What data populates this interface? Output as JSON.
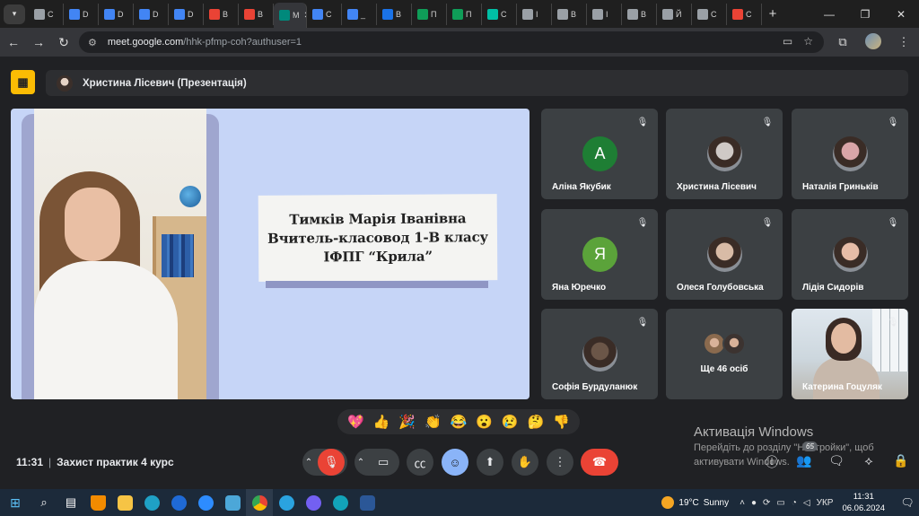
{
  "browser": {
    "tabs": [
      {
        "label": "C",
        "color": "#9aa0a6"
      },
      {
        "label": "D",
        "color": "#4285f4"
      },
      {
        "label": "D",
        "color": "#4285f4"
      },
      {
        "label": "D",
        "color": "#4285f4"
      },
      {
        "label": "D",
        "color": "#4285f4"
      },
      {
        "label": "B",
        "color": "#ea4335"
      },
      {
        "label": "B",
        "color": "#ea4335"
      },
      {
        "label": "M",
        "color": "#00897b",
        "active": true
      },
      {
        "label": "C",
        "color": "#4285f4"
      },
      {
        "label": "_",
        "color": "#4285f4"
      },
      {
        "label": "B",
        "color": "#1a73e8"
      },
      {
        "label": "П",
        "color": "#0f9d58"
      },
      {
        "label": "П",
        "color": "#0f9d58"
      },
      {
        "label": "C",
        "color": "#00bfa5"
      },
      {
        "label": "I",
        "color": "#9aa0a6"
      },
      {
        "label": "B",
        "color": "#9aa0a6"
      },
      {
        "label": "I",
        "color": "#9aa0a6"
      },
      {
        "label": "B",
        "color": "#9aa0a6"
      },
      {
        "label": "Й",
        "color": "#9aa0a6"
      },
      {
        "label": "C",
        "color": "#9aa0a6"
      },
      {
        "label": "C",
        "color": "#ea4335"
      }
    ],
    "url_host": "meet.google.com",
    "url_path": "/hhk-pfmp-coh?authuser=1"
  },
  "meet": {
    "presenter_label": "Христина Лісевич (Презентація)",
    "slide": {
      "line1": "Тимків Марія Іванівна",
      "line2": "Вчитель-класовод 1-В класу",
      "line3": "ІФПГ “Крила”"
    },
    "participants": [
      {
        "name": "Аліна Якубик",
        "initial": "А",
        "color": "#1e7e34",
        "type": "letter"
      },
      {
        "name": "Христина Лісевич",
        "type": "photo",
        "color": "#cfc9c6"
      },
      {
        "name": "Наталія Гриньків",
        "type": "photo",
        "color": "#d9a5a8"
      },
      {
        "name": "Яна Юречко",
        "initial": "Я",
        "color": "#5ba33a",
        "type": "letter"
      },
      {
        "name": "Олеся Голубовська",
        "type": "photo",
        "color": "#d8bba6"
      },
      {
        "name": "Лідія Сидорів",
        "type": "photo",
        "color": "#e6bca7"
      },
      {
        "name": "Софія Бурдуланюк",
        "type": "photo",
        "color": "#6b5648"
      },
      {
        "name": "Ще 46 осіб",
        "type": "more"
      },
      {
        "name": "Катерина Гоцуляк",
        "type": "video"
      }
    ],
    "reactions": [
      "💖",
      "👍",
      "🎉",
      "👏",
      "😂",
      "😮",
      "😢",
      "🤔",
      "👎"
    ],
    "time": "11:31",
    "meeting_title": "Захист практик 4 курс",
    "people_count": "65"
  },
  "watermark": {
    "title": "Активація Windows",
    "subtitle": "Перейдіть до розділу \"Настройки\", щоб активувати Windows."
  },
  "taskbar": {
    "weather_temp": "19°C",
    "weather_text": "Sunny",
    "language": "УКР",
    "time": "11:31",
    "date": "06.06.2024"
  }
}
